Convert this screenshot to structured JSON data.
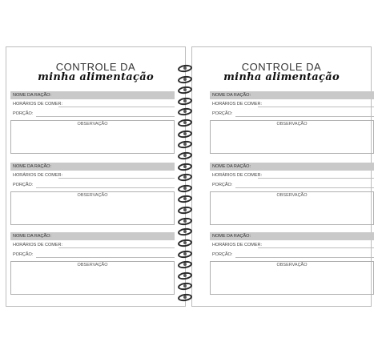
{
  "left_page": {
    "title": "CONTROLE DA",
    "subtitle": "minha alimentação",
    "sections": [
      {
        "name_label": "NOME DA RAÇÃO:",
        "schedule_label": "HORÁRIOS DE COMER:",
        "portion_label": "PORÇÃO:",
        "notes_label": "OBSERVAÇÃO"
      },
      {
        "name_label": "NOME DA RAÇÃO:",
        "schedule_label": "HORÁRIOS DE COMER:",
        "portion_label": "PORÇÃO:",
        "notes_label": "OBSERVAÇÃO"
      },
      {
        "name_label": "NOME DA RAÇÃO:",
        "schedule_label": "HORÁRIOS DE COMER:",
        "portion_label": "PORÇÃO:",
        "notes_label": "OBSERVAÇÃO"
      }
    ]
  },
  "right_page": {
    "title": "CONTROLE DA",
    "subtitle": "minha alimentação",
    "sections": [
      {
        "name_label": "NOME DA RAÇÃO:",
        "schedule_label": "HORÁRIOS DE COMER:",
        "portion_label": "PORÇÃO:",
        "notes_label": "OBSERVAÇÃO"
      },
      {
        "name_label": "NOME DA RAÇÃO:",
        "schedule_label": "HORÁRIOS DE COMER:",
        "portion_label": "PORÇÃO:",
        "notes_label": "OBSERVAÇÃO"
      },
      {
        "name_label": "NOME DA RAÇÃO:",
        "schedule_label": "HORÁRIOS DE COMER:",
        "portion_label": "PORÇÃO:",
        "notes_label": "OBSERVAÇÃO"
      }
    ]
  },
  "colors": {
    "header_bar": "#c9c9c9",
    "rings": "#2a2a2a",
    "page_border": "#bdbdbd"
  },
  "binding": {
    "icon": "spiral-ring-icon",
    "ring_count": 22
  }
}
